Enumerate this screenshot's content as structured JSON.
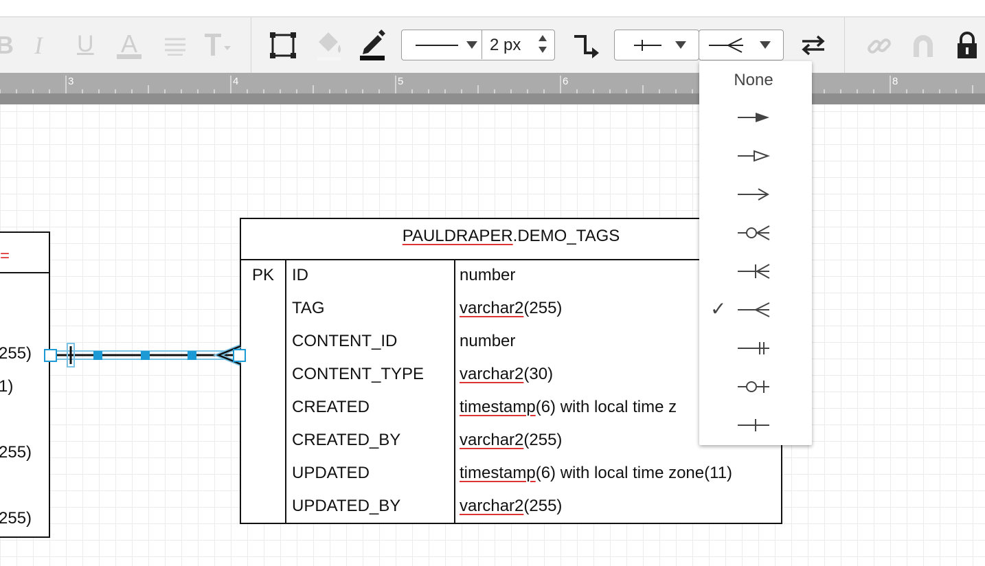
{
  "toolbar": {
    "text_format_icons": [
      "bold-icon",
      "italic-icon",
      "underline-icon",
      "font-color-icon",
      "align-icon",
      "text-size-icon"
    ],
    "line_width": "2 px",
    "start_arrow": "one-mandatory",
    "end_arrow": "many",
    "right_icons": [
      "swap-icon",
      "link-icon",
      "magnet-icon",
      "lock-icon"
    ]
  },
  "ruler": {
    "labels": [
      "3",
      "4",
      "5",
      "6",
      "8"
    ]
  },
  "table": {
    "title_owner": "PAULDRAPER",
    "title_rest": ".DEMO_TAGS",
    "pk_label": "PK",
    "rows": [
      {
        "name": "ID",
        "type_a": "",
        "type_b": "number"
      },
      {
        "name": "TAG",
        "type_a": "varchar2",
        "type_b": "(255)"
      },
      {
        "name": "CONTENT_ID",
        "type_a": "",
        "type_b": "number"
      },
      {
        "name": "CONTENT_TYPE",
        "type_a": "varchar2",
        "type_b": "(30)"
      },
      {
        "name": "CREATED",
        "type_a": "timestamp",
        "type_b": "(6) with local time z"
      },
      {
        "name": "CREATED_BY",
        "type_a": "varchar2",
        "type_b": "(255)"
      },
      {
        "name": "UPDATED",
        "type_a": "timestamp",
        "type_b": "(6) with local time zone(11)"
      },
      {
        "name": "UPDATED_BY",
        "type_a": "varchar2",
        "type_b": "(255)"
      }
    ]
  },
  "left_table": {
    "fragments": [
      "255)",
      "1)",
      "255)",
      "255)"
    ],
    "title_fragment": "="
  },
  "dropdown": {
    "none_label": "None",
    "options": [
      "none",
      "filled-arrow",
      "open-triangle",
      "line-arrow",
      "zero-or-many",
      "one-or-many",
      "many",
      "one-mandatory",
      "zero-or-one",
      "one"
    ],
    "selected": "many",
    "check_glyph": "✓"
  }
}
